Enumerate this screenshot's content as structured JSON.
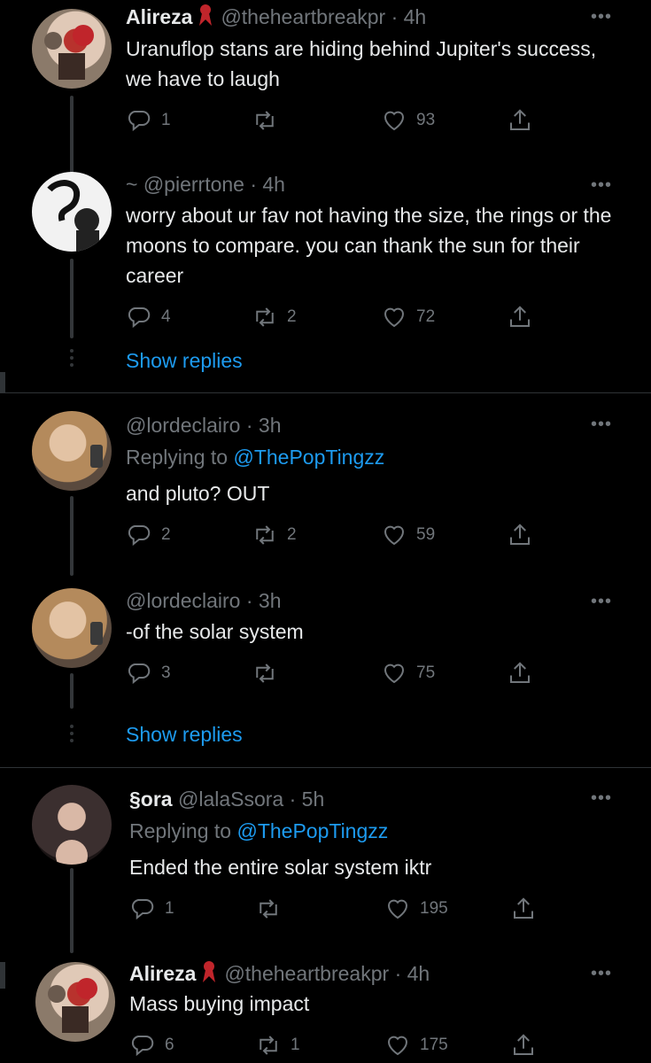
{
  "tweets": [
    {
      "name": "Alireza",
      "handle": "@theheartbreakpr",
      "time": "· 4h",
      "replying_label": "",
      "replying_to": "",
      "text": "Uranuflop stans are hiding behind Jupiter's success, we have to laugh",
      "replies": "1",
      "retweets": "",
      "likes": "93"
    },
    {
      "name": "~",
      "handle": "@pierrtone",
      "time": "· 4h",
      "replying_label": "",
      "replying_to": "",
      "text": "worry about ur fav not having the size, the rings or the moons to compare. you can thank the sun for their career",
      "replies": "4",
      "retweets": "2",
      "likes": "72"
    },
    {
      "name": "",
      "handle": "@lordeclairo",
      "time": "· 3h",
      "replying_label": "Replying to",
      "replying_to": "@ThePopTingzz",
      "text": "and pluto? OUT",
      "replies": "2",
      "retweets": "2",
      "likes": "59"
    },
    {
      "name": "",
      "handle": "@lordeclairo",
      "time": "· 3h",
      "replying_label": "",
      "replying_to": "",
      "text": "-of the solar system",
      "replies": "3",
      "retweets": "",
      "likes": "75"
    },
    {
      "name": "§ora",
      "handle": "@lalaSsora",
      "time": "· 5h",
      "replying_label": "Replying to",
      "replying_to": "@ThePopTingzz",
      "text": "Ended the entire solar system iktr",
      "replies": "1",
      "retweets": "",
      "likes": "195"
    },
    {
      "name": "Alireza",
      "handle": "@theheartbreakpr",
      "time": "· 4h",
      "replying_label": "",
      "replying_to": "",
      "text": "Mass buying impact",
      "replies": "6",
      "retweets": "1",
      "likes": "175"
    }
  ],
  "show_replies": [
    "Show replies",
    "Show replies"
  ],
  "more_label": "•••",
  "icons": {
    "reply": "reply-icon",
    "retweet": "retweet-icon",
    "like": "heart-icon",
    "share": "share-icon",
    "badge": "ribbon-icon",
    "more": "more-icon"
  },
  "colors": {
    "background": "#000000",
    "text": "#e7e9ea",
    "muted": "#71767b",
    "link": "#1d9bf0",
    "badge": "#c0252b"
  }
}
